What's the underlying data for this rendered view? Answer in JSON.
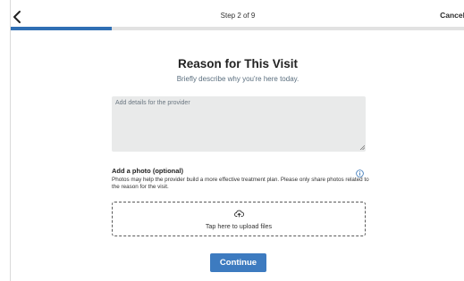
{
  "header": {
    "step_label": "Step 2 of 9",
    "cancel_label": "Cancel"
  },
  "progress": {
    "current_step": 2,
    "total_steps": 9,
    "fraction": 0.222
  },
  "main": {
    "title": "Reason for This Visit",
    "subtitle": "Briefly describe why you're here today.",
    "details_placeholder": "Add details for the provider",
    "details_value": ""
  },
  "photo": {
    "heading": "Add a photo (optional)",
    "description": "Photos may help the provider build a more effective treatment plan. Please only share photos related to the reason for the visit.",
    "upload_label": "Tap here to upload files"
  },
  "footer": {
    "continue_label": "Continue"
  },
  "colors": {
    "accent": "#3d7bc0",
    "progress_fill": "#2f6fb4",
    "progress_track": "#e2e2e2",
    "input_background": "#e9eaea",
    "info_icon": "#2f6fb4"
  },
  "icons": {
    "back": "chevron-left-icon",
    "info": "info-icon",
    "upload": "cloud-upload-icon"
  }
}
